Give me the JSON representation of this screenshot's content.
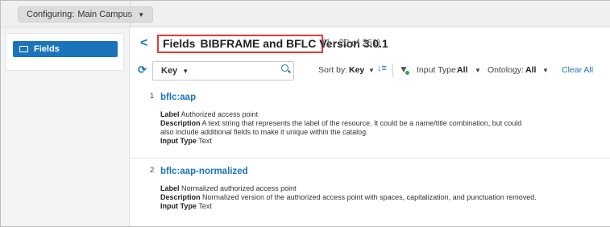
{
  "topbar": {
    "configuring_label": "Configuring:",
    "configuring_value": "Main Campus"
  },
  "sidebar": {
    "items": [
      {
        "label": "Fields",
        "icon": "rectangle-icon",
        "active": true
      }
    ]
  },
  "header": {
    "title_prefix": "Fields",
    "title_profile": "BIBFRAME and BFLC Version 3.0.1",
    "count": "(1 - 20 of 261)"
  },
  "toolbar": {
    "search_field_select": "Key",
    "search_value": "",
    "sort_by_label": "Sort by:",
    "sort_by_value": "Key",
    "input_type_label": "Input Type:",
    "input_type_value": "All",
    "ontology_label": "Ontology:",
    "ontology_value": "All",
    "clear_all": "Clear All"
  },
  "records": [
    {
      "number": "1",
      "key": "bflc:aap",
      "label_caption": "Label",
      "label": "Authorized access point",
      "description_caption": "Description",
      "description_line1": "A text string that represents the label of the resource. It could be a name/title combination, but could",
      "description_line2": "also include additional fields to make it unique within the catalog.",
      "input_type_caption": "Input Type",
      "input_type": "Text"
    },
    {
      "number": "2",
      "key": "bflc:aap-normalized",
      "label_caption": "Label",
      "label": "Normalized authorized access point",
      "description_caption": "Description",
      "description_line1": "Normalized version of the authorized access point with spaces, capitalization, and punctuation removed.",
      "input_type_caption": "Input Type",
      "input_type": "Text"
    }
  ],
  "colors": {
    "accent": "#1b74bb",
    "highlight_box": "#e53b3b",
    "filter_active": "#2eaa4a"
  }
}
